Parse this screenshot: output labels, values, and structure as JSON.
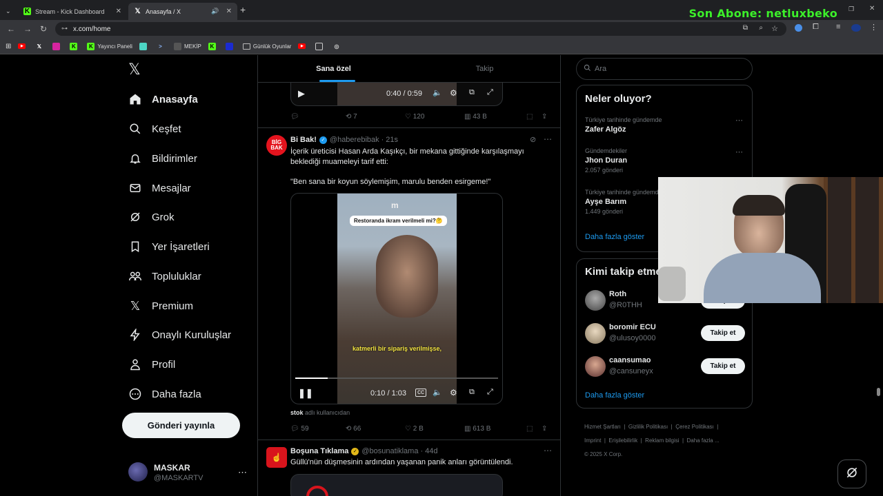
{
  "browser": {
    "tabs": [
      {
        "title": "Stream - Kick Dashboard"
      },
      {
        "title": "Anasayfa / X"
      }
    ],
    "url": "x.com/home",
    "bookmarks": [
      "Yayıncı Paneli",
      "MEKİP",
      "Günlük Oyunlar"
    ]
  },
  "overlay": {
    "subscriber": "Son Abone: netluxbeko"
  },
  "sidebar": {
    "items": [
      {
        "label": "Anasayfa"
      },
      {
        "label": "Keşfet"
      },
      {
        "label": "Bildirimler"
      },
      {
        "label": "Mesajlar"
      },
      {
        "label": "Grok"
      },
      {
        "label": "Yer İşaretleri"
      },
      {
        "label": "Topluluklar"
      },
      {
        "label": "Premium"
      },
      {
        "label": "Onaylı Kuruluşlar"
      },
      {
        "label": "Profil"
      },
      {
        "label": "Daha fazla"
      }
    ],
    "post_button": "Gönderi yayınla",
    "account": {
      "name": "MASKAR",
      "handle": "@MASKARTV"
    }
  },
  "feed": {
    "tabs": [
      "Sana özel",
      "Takip"
    ],
    "top_video": {
      "time": "0:40 / 0:59"
    },
    "top_actions": {
      "reposts": "7",
      "likes": "120",
      "views": "43 B"
    },
    "tweet1": {
      "name": "Bi Bak!",
      "handle": "@haberebibak",
      "time": "21s",
      "text": "İçerik üreticisi Hasan Arda Kaşıkçı, bir mekana gittiğinde karşılaşmayı beklediği muameleyi tarif etti:",
      "quote": "\"Ben sana bir koyun söylemişim, marulu benden esirgeme!\"",
      "video_caption": "Restoranda ikram verilmeli mi?🤔",
      "video_subtitle": "katmerli bir sipariş verilmişse,",
      "video_time": "0:10 / 1:03",
      "source_user": "stok",
      "source_suffix": "adlı kullanıcıdan",
      "replies": "59",
      "reposts": "66",
      "likes": "2 B",
      "views": "613 B"
    },
    "tweet2": {
      "name": "Boşuna Tıklama",
      "handle": "@bosunatiklama",
      "time": "44d",
      "text": "Güllü'nün düşmesinin ardından yaşanan panik anları görüntülendi."
    }
  },
  "right": {
    "search_placeholder": "Ara",
    "trends_title": "Neler oluyor?",
    "trends": [
      {
        "context": "Türkiye tarihinde gündemde",
        "title": "Zafer Algöz",
        "posts": ""
      },
      {
        "context": "Gündemdekiler",
        "title": "Jhon Duran",
        "posts": "2.057 gönderi"
      },
      {
        "context": "Türkiye tarihinde gündemde",
        "title": "Ayşe Barım",
        "posts": "1.449 gönderi"
      }
    ],
    "show_more": "Daha fazla göster",
    "who_title": "Kimi takip etmeli",
    "who": [
      {
        "name": "Roth",
        "handle": "@R0THH"
      },
      {
        "name": "boromir ECU",
        "handle": "@ulusoy0000"
      },
      {
        "name": "caansumao",
        "handle": "@cansuneyx"
      }
    ],
    "follow_label": "Takip et",
    "footer": [
      "Hizmet Şartları",
      "Gizlilik Politikası",
      "Çerez Politikası",
      "Imprint",
      "Erişilebilirlik",
      "Reklam bilgisi",
      "Daha fazla ...",
      "© 2025 X Corp."
    ]
  }
}
